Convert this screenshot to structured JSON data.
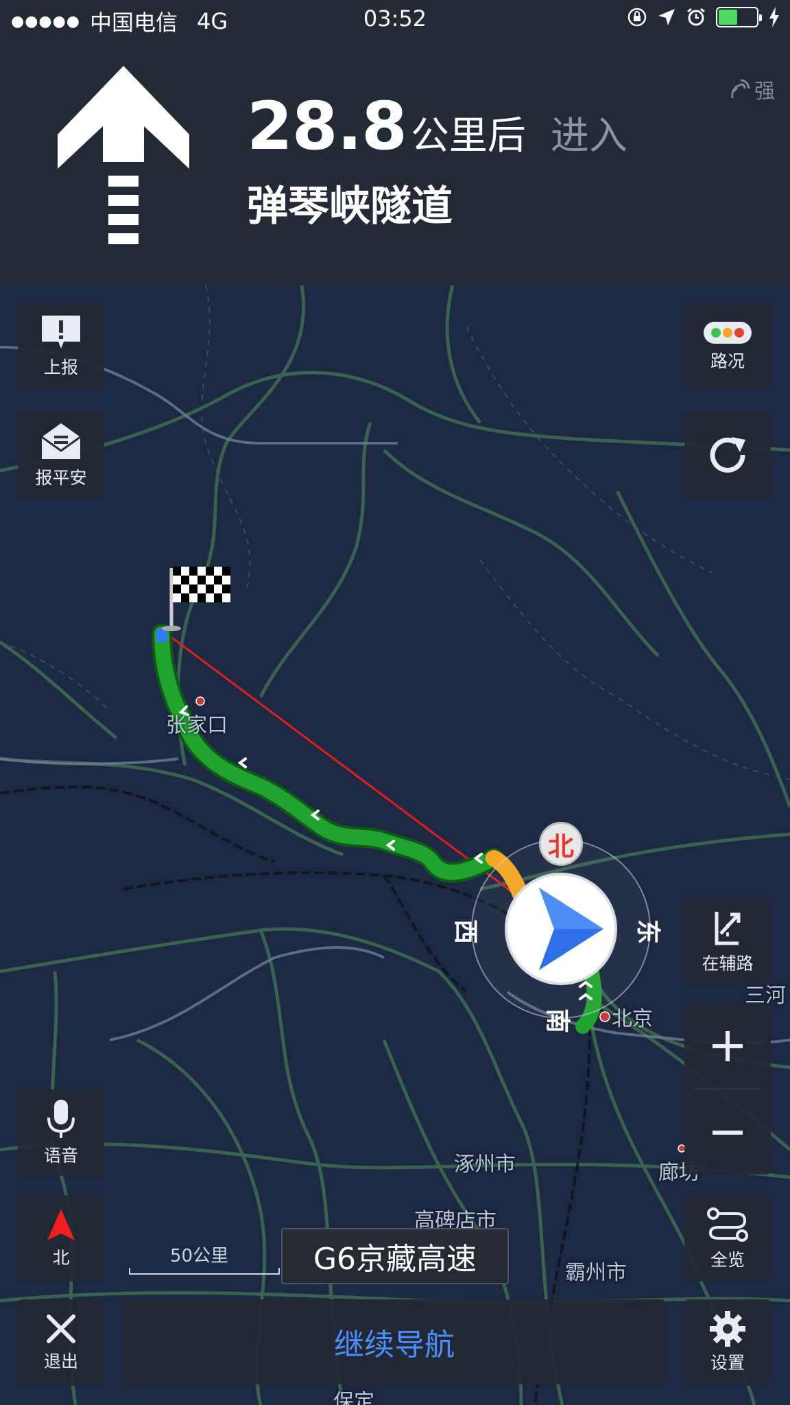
{
  "status_bar": {
    "signal_dots": "●●●●●",
    "carrier": "中国电信",
    "network": "4G",
    "time": "03:52",
    "battery_level": 0.5,
    "icons": [
      "rotation-lock-icon",
      "location-arrow-icon",
      "alarm-icon",
      "battery-icon",
      "charging-bolt-icon"
    ]
  },
  "guidance": {
    "distance_value": "28.8",
    "distance_unit": "公里后",
    "action": "进入",
    "road_name": "弹琴峡隧道",
    "gps_signal_label": "强",
    "turn_icon": "straight-arrow-icon"
  },
  "map": {
    "cities": {
      "zhangjiakou": "张家口",
      "beijing": "北京",
      "zhuozhou": "涿州市",
      "gaobeidian": "高碑店市",
      "bazhou": "霸州市",
      "langfang": "廊坊",
      "sanhe": "三河",
      "baoding": "保定"
    },
    "compass": {
      "north": "北",
      "south": "南",
      "east": "东",
      "west": "西"
    },
    "scale_label": "50公里",
    "current_road": "G6京藏高速",
    "route_colors": {
      "smooth": "#1fa52f",
      "slow": "#f5a623",
      "straight_line": "#e01e1e"
    }
  },
  "buttons": {
    "report": "上报",
    "safety": "报平安",
    "traffic": "路况",
    "refresh_icon": "refresh-icon",
    "side_road": "在辅路",
    "zoom_in_icon": "plus-icon",
    "zoom_out_icon": "minus-icon",
    "voice": "语音",
    "north_up": "北",
    "overview": "全览",
    "exit": "退出",
    "continue_nav": "继续导航",
    "settings": "设置"
  }
}
